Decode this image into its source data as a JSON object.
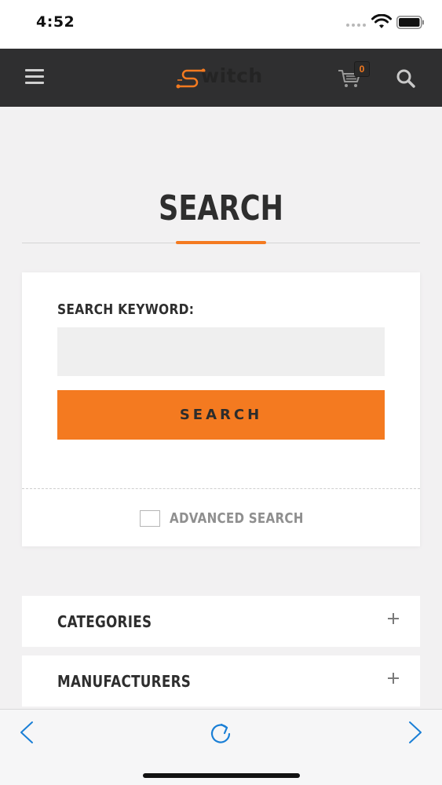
{
  "status_bar": {
    "time": "4:52"
  },
  "header": {
    "logo_text": "witch",
    "cart_count": "0",
    "accent_color": "#f47a20",
    "icons": [
      "menu-icon",
      "cart-icon",
      "search-icon"
    ]
  },
  "page": {
    "title": "SEARCH"
  },
  "search_form": {
    "keyword_label": "SEARCH KEYWORD:",
    "keyword_value": "",
    "keyword_placeholder": "",
    "search_button_label": "SEARCH",
    "advanced_search_label": "ADVANCED SEARCH",
    "advanced_checked": false
  },
  "filters": {
    "items": [
      {
        "label": "CATEGORIES"
      },
      {
        "label": "MANUFACTURERS"
      }
    ]
  },
  "browser_toolbar": {
    "icons": [
      "back-arrow-icon",
      "reload-icon",
      "forward-arrow-icon"
    ],
    "accent_color": "#1a7fd6"
  }
}
